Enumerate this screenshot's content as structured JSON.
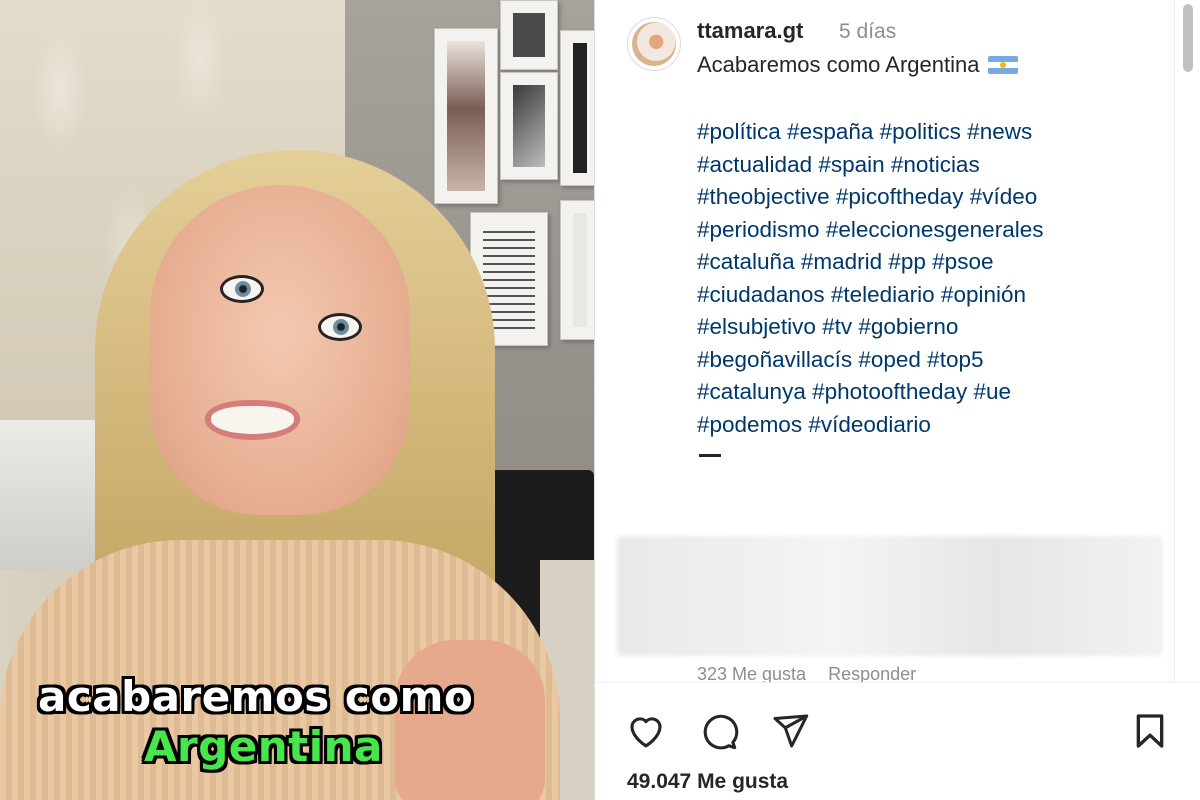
{
  "video": {
    "caption_line1": "acabaremos como",
    "caption_line2": "Argentina",
    "caption_line2_color": "#46e64c"
  },
  "post": {
    "username": "ttamara.gt",
    "time": "5 días",
    "caption": "Acabaremos como Argentina",
    "caption_flag_icon": "argentina-flag-icon",
    "hashtag_lines": [
      "#política #españa #politics #news",
      "#actualidad #spain #noticias",
      "#theobjective #picoftheday #vídeo",
      "#periodismo #eleccionesgenerales",
      "#cataluña #madrid #pp #psoe",
      "#ciudadanos #telediario #opinión",
      "#elsubjetivo #tv #gobierno",
      "#begoñavillacís #oped #top5",
      "#catalunya #photooftheday #ue",
      "#podemos #vídeodiario"
    ],
    "hashtag_color": "#00376b",
    "comment": {
      "likes": "323 Me gusta",
      "reply": "Responder"
    },
    "actions": {
      "like_icon": "heart-icon",
      "comment_icon": "comment-icon",
      "share_icon": "send-icon",
      "save_icon": "bookmark-icon"
    },
    "likes": "49.047 Me gusta"
  }
}
